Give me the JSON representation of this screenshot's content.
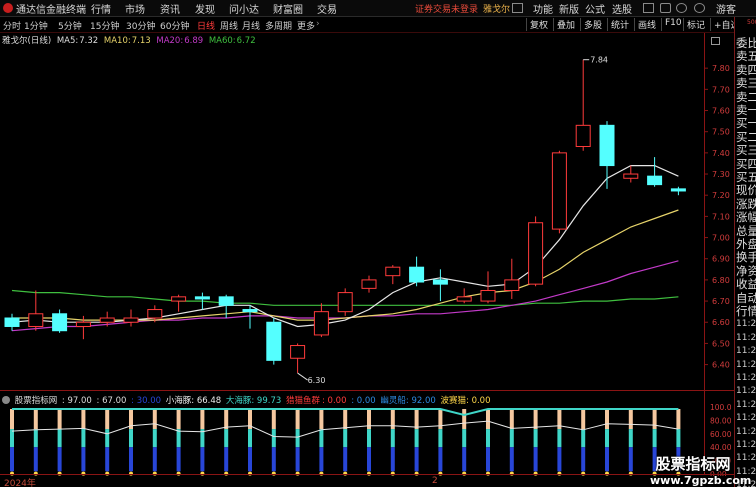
{
  "menubar": {
    "app_title": "通达信金融终端",
    "menus": [
      "行情",
      "市场",
      "资讯",
      "发现",
      "问小达",
      "财富圈",
      "交易"
    ],
    "notice": "证券交易未登录",
    "stock_name": "雅戈尔",
    "right_menus": [
      "功能",
      "新版",
      "公式",
      "选股"
    ],
    "user": "游客"
  },
  "toolbar": {
    "periods": [
      "分时",
      "1分钟",
      "5分钟",
      "15分钟",
      "30分钟",
      "60分钟",
      "日线",
      "周线",
      "月线",
      "多周期",
      "更多"
    ],
    "active_period": "日线",
    "more_icon": "chevron-right-icon",
    "right_buttons": [
      "复权",
      "叠加",
      "多股",
      "统计",
      "画线",
      "F10",
      "标记",
      "+自选"
    ],
    "back_icon": "back-arrow-icon"
  },
  "indicator_line": {
    "title": "雅戈尔(日线)",
    "ma5_label": "MA5:",
    "ma5": "7.32",
    "ma10_label": "MA10:",
    "ma10": "7.13",
    "ma20_label": "MA20:",
    "ma20": "6.89",
    "ma60_label": "MA60:",
    "ma60": "6.72",
    "colors": {
      "ma5": "#e6e6e6",
      "ma10": "#e6d36a",
      "ma20": "#c23ac8",
      "ma60": "#3fbf3f"
    }
  },
  "price_axis": [
    "7.80",
    "7.70",
    "7.60",
    "7.50",
    "7.40",
    "7.30",
    "7.20",
    "7.10",
    "7.00",
    "6.90",
    "6.80",
    "6.70",
    "6.60",
    "6.50",
    "6.40"
  ],
  "volume_axis": [
    "100.0",
    "80.00",
    "60.00",
    "40.00",
    "20.00",
    "0.00"
  ],
  "annotations": {
    "high": "7.84",
    "low": "6.30"
  },
  "sub_indicator": {
    "name": "股票指标网",
    "v1": ": 97.00",
    "v2": ": 67.00",
    "v3": ": 30.00",
    "xiaohaitun": "小海豚: 66.48",
    "dahaitun": "大海豚: 99.73",
    "label_red": "猎猫鱼群",
    "label_red_val": ": 0.00",
    "label_blue": ": 0.00",
    "youlingzhou": "幽灵船: 92.00",
    "zhuobu": "波赛猫: 0.00"
  },
  "right_panel": [
    "委比",
    "卖五",
    "卖四",
    "卖三",
    "卖二",
    "卖一",
    "买一",
    "买二",
    "买三",
    "买四",
    "买五",
    "现价",
    "涨跌",
    "涨幅",
    "总量",
    "外盘",
    "换手",
    "净资",
    "收益",
    "自动",
    "行情",
    "11:2",
    "11:2",
    "11:2",
    "11:2",
    "11:2",
    "11:2",
    "11:2",
    "11:2",
    "11:2",
    "11:2",
    "11:2",
    "11:2",
    "11:2"
  ],
  "right_top": "500",
  "x_axis": {
    "year": "2024年",
    "month": "2"
  },
  "watermark": {
    "line1": "股票指标网",
    "line2": "www.7gpzb.com"
  },
  "chart_data": {
    "type": "candlestick",
    "ylim": [
      6.28,
      7.9
    ],
    "candles": [
      {
        "o": 6.62,
        "c": 6.58,
        "h": 6.64,
        "l": 6.56
      },
      {
        "o": 6.58,
        "c": 6.64,
        "h": 6.75,
        "l": 6.56
      },
      {
        "o": 6.64,
        "c": 6.56,
        "h": 6.66,
        "l": 6.55
      },
      {
        "o": 6.58,
        "c": 6.6,
        "h": 6.63,
        "l": 6.52
      },
      {
        "o": 6.6,
        "c": 6.62,
        "h": 6.65,
        "l": 6.58
      },
      {
        "o": 6.6,
        "c": 6.62,
        "h": 6.66,
        "l": 6.58
      },
      {
        "o": 6.62,
        "c": 6.66,
        "h": 6.68,
        "l": 6.6
      },
      {
        "o": 6.7,
        "c": 6.72,
        "h": 6.73,
        "l": 6.65
      },
      {
        "o": 6.72,
        "c": 6.71,
        "h": 6.74,
        "l": 6.66
      },
      {
        "o": 6.72,
        "c": 6.68,
        "h": 6.73,
        "l": 6.62
      },
      {
        "o": 6.66,
        "c": 6.65,
        "h": 6.68,
        "l": 6.57
      },
      {
        "o": 6.6,
        "c": 6.42,
        "h": 6.62,
        "l": 6.4
      },
      {
        "o": 6.43,
        "c": 6.49,
        "h": 6.5,
        "l": 6.36
      },
      {
        "o": 6.54,
        "c": 6.65,
        "h": 6.69,
        "l": 6.53
      },
      {
        "o": 6.65,
        "c": 6.74,
        "h": 6.76,
        "l": 6.63
      },
      {
        "o": 6.76,
        "c": 6.8,
        "h": 6.82,
        "l": 6.74
      },
      {
        "o": 6.82,
        "c": 6.86,
        "h": 6.87,
        "l": 6.78
      },
      {
        "o": 6.86,
        "c": 6.79,
        "h": 6.91,
        "l": 6.77
      },
      {
        "o": 6.8,
        "c": 6.78,
        "h": 6.85,
        "l": 6.7
      },
      {
        "o": 6.7,
        "c": 6.72,
        "h": 6.76,
        "l": 6.69
      },
      {
        "o": 6.7,
        "c": 6.75,
        "h": 6.84,
        "l": 6.69
      },
      {
        "o": 6.75,
        "c": 6.8,
        "h": 6.9,
        "l": 6.71
      },
      {
        "o": 6.78,
        "c": 7.07,
        "h": 7.1,
        "l": 6.77
      },
      {
        "o": 7.04,
        "c": 7.4,
        "h": 7.41,
        "l": 7.02
      },
      {
        "o": 7.43,
        "c": 7.53,
        "h": 7.84,
        "l": 7.41
      },
      {
        "o": 7.53,
        "c": 7.34,
        "h": 7.55,
        "l": 7.23
      },
      {
        "o": 7.28,
        "c": 7.3,
        "h": 7.34,
        "l": 7.26
      },
      {
        "o": 7.29,
        "c": 7.25,
        "h": 7.38,
        "l": 7.24
      },
      {
        "o": 7.23,
        "c": 7.22,
        "h": 7.24,
        "l": 7.2
      }
    ],
    "ma5": [
      6.6,
      6.61,
      6.6,
      6.6,
      6.6,
      6.61,
      6.62,
      6.64,
      6.66,
      6.68,
      6.68,
      6.62,
      6.58,
      6.59,
      6.61,
      6.66,
      6.74,
      6.79,
      6.81,
      6.79,
      6.77,
      6.78,
      6.86,
      6.99,
      7.15,
      7.28,
      7.34,
      7.34,
      7.29
    ],
    "ma10": [
      6.62,
      6.62,
      6.62,
      6.61,
      6.61,
      6.61,
      6.61,
      6.62,
      6.63,
      6.64,
      6.65,
      6.63,
      6.61,
      6.61,
      6.62,
      6.63,
      6.64,
      6.66,
      6.69,
      6.72,
      6.74,
      6.75,
      6.79,
      6.85,
      6.93,
      6.99,
      7.05,
      7.09,
      7.13
    ],
    "ma20": [
      6.56,
      6.57,
      6.58,
      6.58,
      6.59,
      6.6,
      6.61,
      6.61,
      6.62,
      6.62,
      6.63,
      6.63,
      6.62,
      6.62,
      6.62,
      6.63,
      6.63,
      6.64,
      6.64,
      6.65,
      6.66,
      6.68,
      6.7,
      6.73,
      6.76,
      6.79,
      6.83,
      6.86,
      6.89
    ],
    "ma60": [
      6.75,
      6.74,
      6.74,
      6.73,
      6.72,
      6.72,
      6.71,
      6.7,
      6.7,
      6.69,
      6.69,
      6.68,
      6.68,
      6.68,
      6.68,
      6.68,
      6.68,
      6.68,
      6.68,
      6.68,
      6.68,
      6.68,
      6.69,
      6.69,
      6.7,
      6.7,
      6.71,
      6.71,
      6.72
    ],
    "sub_upper_line": [
      97,
      97,
      97,
      97,
      97,
      97,
      97,
      97,
      97,
      97,
      97,
      97,
      97,
      97,
      97,
      97,
      97,
      97,
      97,
      88,
      97,
      97,
      97,
      97,
      97,
      97,
      97,
      97,
      97
    ],
    "sub_white_line": [
      64,
      66,
      67,
      68,
      60,
      72,
      75,
      64,
      63,
      70,
      72,
      56,
      55,
      66,
      69,
      72,
      72,
      70,
      72,
      76,
      79,
      68,
      70,
      72,
      66,
      75,
      74,
      73,
      67
    ]
  }
}
